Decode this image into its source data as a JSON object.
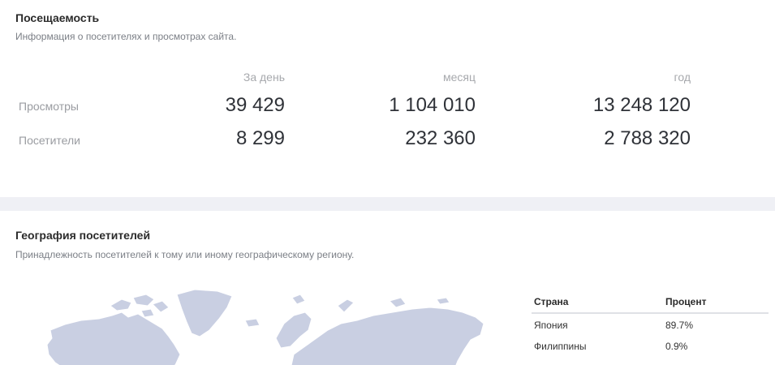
{
  "attendance": {
    "title": "Посещаемость",
    "subtitle": "Информация о посетителях и просмотрах сайта.",
    "columns": [
      "За день",
      "месяц",
      "год"
    ],
    "rows": [
      {
        "label": "Просмотры",
        "values": [
          "39 429",
          "1 104 010",
          "13 248 120"
        ]
      },
      {
        "label": "Посетители",
        "values": [
          "8 299",
          "232 360",
          "2 788 320"
        ]
      }
    ]
  },
  "geography": {
    "title": "География посетителей",
    "subtitle": "Принадлежность посетителей к тому или иному географическому региону.",
    "table": {
      "headers": [
        "Страна",
        "Процент"
      ],
      "rows": [
        {
          "country": "Япония",
          "percent": "89.7%"
        },
        {
          "country": "Филиппины",
          "percent": "0.9%"
        }
      ]
    }
  },
  "colors": {
    "map_fill": "#c9cfe2",
    "separator": "#eff0f5",
    "muted_text": "#a7a9ad"
  }
}
